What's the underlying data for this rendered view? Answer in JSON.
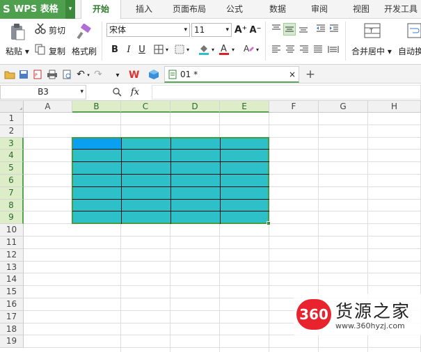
{
  "app": {
    "logo_letter": "S",
    "name": "WPS 表格"
  },
  "menu_tabs": [
    "开始",
    "插入",
    "页面布局",
    "公式",
    "数据",
    "审阅",
    "视图",
    "开发工具"
  ],
  "ribbon": {
    "paste": "粘贴",
    "cut": "剪切",
    "copy": "复制",
    "format_painter": "格式刷",
    "font_name": "宋体",
    "font_size": "11",
    "bold": "B",
    "italic": "I",
    "underline": "U",
    "increase_font": "A⁺",
    "decrease_font": "A⁻",
    "merge_center": "合并居中",
    "auto_wrap": "自动换行"
  },
  "quick_access": {
    "doc_tab_label": "01 *"
  },
  "formula_bar": {
    "name_box": "B3",
    "fx": "fx",
    "formula_value": ""
  },
  "columns": [
    "A",
    "B",
    "C",
    "D",
    "E",
    "F",
    "G",
    "H"
  ],
  "rows": [
    "1",
    "2",
    "3",
    "4",
    "5",
    "6",
    "7",
    "8",
    "9",
    "10",
    "11",
    "12",
    "13",
    "14",
    "15",
    "16",
    "17",
    "18",
    "19"
  ],
  "selection": {
    "range_start": "B3",
    "range_end": "E9",
    "fill_color": "#2ec0c8",
    "active_color": "#0a9ff0",
    "border_color": "#4a9c43"
  },
  "watermark": {
    "badge": "360",
    "title": "货源之家",
    "url": "www.360hyzj.com"
  }
}
